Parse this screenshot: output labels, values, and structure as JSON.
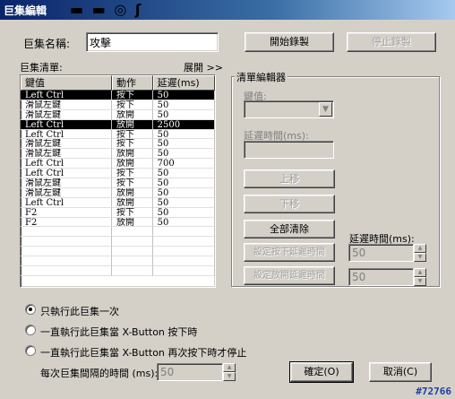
{
  "window": {
    "title": "巨集編輯"
  },
  "form": {
    "macro_name_label": "巨集名稱:",
    "macro_name_value": "攻擊",
    "start_record_label": "開始錄製",
    "stop_record_label": "停止錄製",
    "list_label": "巨集清單:",
    "expand_label": "展開 >>"
  },
  "list": {
    "headers": [
      "鍵值",
      "動作",
      "延遲(ms)"
    ],
    "rows": [
      [
        "Left Ctrl",
        "按下",
        "50"
      ],
      [
        "滑鼠左鍵",
        "按下",
        "50"
      ],
      [
        "滑鼠左鍵",
        "放開",
        "50"
      ],
      [
        "Left Ctrl",
        "放開",
        "2500"
      ],
      [
        "Left Ctrl",
        "按下",
        "50"
      ],
      [
        "滑鼠左鍵",
        "按下",
        "50"
      ],
      [
        "滑鼠左鍵",
        "放開",
        "50"
      ],
      [
        "Left Ctrl",
        "放開",
        "700"
      ],
      [
        "Left Ctrl",
        "按下",
        "50"
      ],
      [
        "滑鼠左鍵",
        "按下",
        "50"
      ],
      [
        "滑鼠左鍵",
        "放開",
        "50"
      ],
      [
        "Left Ctrl",
        "放開",
        "50"
      ],
      [
        "F2",
        "按下",
        "50"
      ],
      [
        "F2",
        "放開",
        "50"
      ]
    ]
  },
  "editor": {
    "title": "清單編輯器",
    "key_label": "鍵值:",
    "delay_label": "延遲時間(ms):",
    "move_up": "上移",
    "move_down": "下移",
    "clear_all": "全部清除",
    "set_press_delay": "設定按下延遲時間",
    "set_release_delay": "設定放開延遲時間",
    "delay_label2": "延遲時間(ms):",
    "press_delay_value": "50",
    "release_delay_value": "50"
  },
  "options": {
    "run_once": "只執行此巨集一次",
    "run_while_pressed": "一直執行此巨集當 X-Button 按下時",
    "run_until_pressed": "一直執行此巨集當 X-Button 再次按下時才停止",
    "selected": "run_once",
    "interval_label": "每次巨集間隔的時間 (ms):",
    "interval_value": "50"
  },
  "footer": {
    "ok": "確定(O)",
    "cancel": "取消(C)",
    "watermark": "#72766"
  }
}
